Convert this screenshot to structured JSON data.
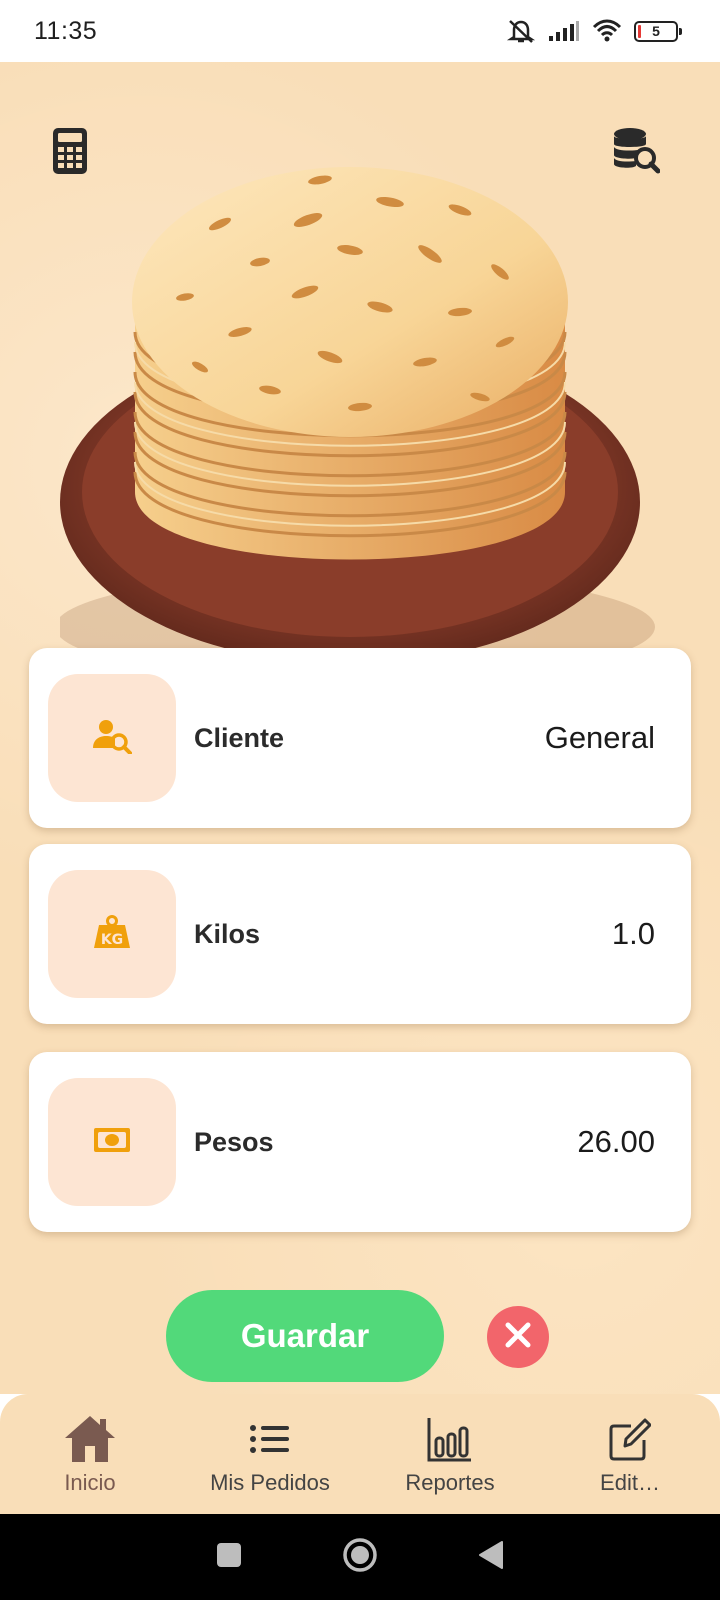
{
  "status_bar": {
    "time": "11:35",
    "battery_level": "5",
    "icons": [
      "mute-icon",
      "signal-icon",
      "wifi-icon",
      "battery-icon"
    ]
  },
  "header": {
    "left_icon": "calculator-icon",
    "right_icon": "database-search-icon"
  },
  "form": {
    "cliente": {
      "label": "Cliente",
      "value": "General",
      "icon": "user-search-icon"
    },
    "kilos": {
      "label": "Kilos",
      "value": "1.0",
      "icon": "kg-weight-icon"
    },
    "pesos": {
      "label": "Pesos",
      "value": "26.00",
      "icon": "money-bill-icon"
    }
  },
  "actions": {
    "save_label": "Guardar",
    "cancel_icon": "close-icon"
  },
  "bottom_nav": {
    "items": [
      {
        "label": "Inicio",
        "icon": "home-icon",
        "active": true
      },
      {
        "label": "Mis Pedidos",
        "icon": "list-icon",
        "active": false
      },
      {
        "label": "Reportes",
        "icon": "bar-chart-icon",
        "active": false
      },
      {
        "label": "Edit…",
        "icon": "edit-icon",
        "active": false
      }
    ]
  },
  "colors": {
    "background": "#f9deb8",
    "accent_orange": "#f0a00c",
    "save_green": "#52d97a",
    "cancel_red": "#f2656b",
    "icon_tile": "#fde5d3"
  }
}
